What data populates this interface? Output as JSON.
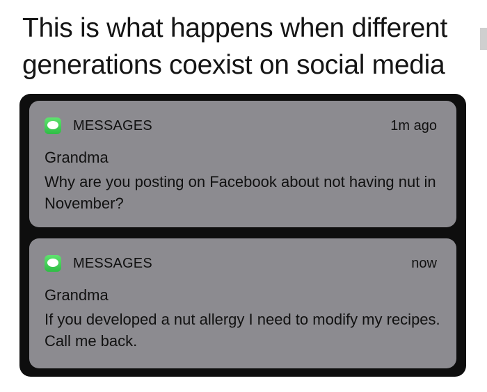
{
  "caption": {
    "line1": "This is what happens when different",
    "line2": "generations coexist on social media"
  },
  "notifications": [
    {
      "app_name": "MESSAGES",
      "time": "1m ago",
      "sender": "Grandma",
      "message": "Why are you posting on Facebook about not having nut in November?",
      "icon": "messages-app-icon"
    },
    {
      "app_name": "MESSAGES",
      "time": "now",
      "sender": "Grandma",
      "message": "If you developed a nut allergy I need to modify my recipes. Call me back.",
      "icon": "messages-app-icon"
    }
  ],
  "colors": {
    "notification_background": "#8c8b90",
    "outer_background": "#0e0e0e",
    "icon_green": "#2fbd45"
  }
}
